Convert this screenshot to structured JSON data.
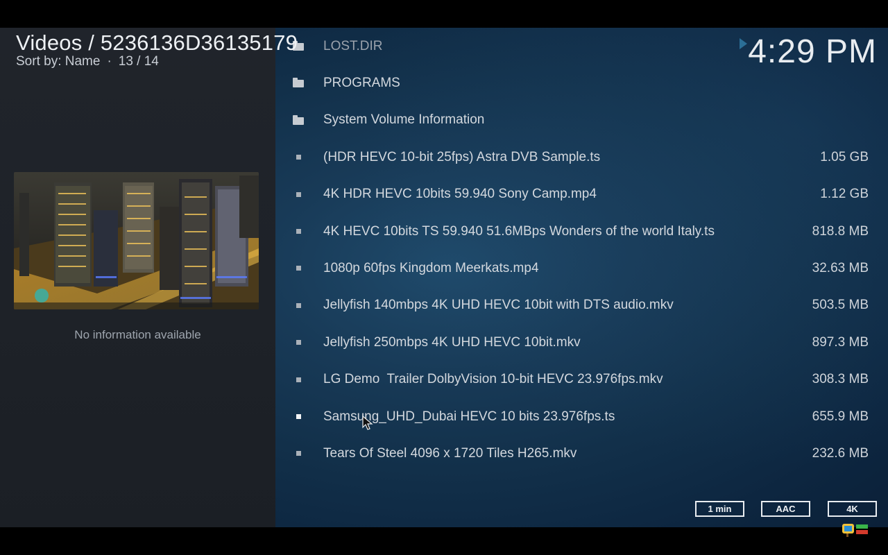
{
  "header": {
    "title": "Videos / 5236136D36135179",
    "sort_label": "Sort by: Name",
    "separator": "·",
    "position": "13 / 14"
  },
  "clock": "4:29 PM",
  "info_panel": {
    "no_info_text": "No information available"
  },
  "files": [
    {
      "type": "folder",
      "name": "LOST.DIR",
      "size": ""
    },
    {
      "type": "folder",
      "name": "PROGRAMS",
      "size": ""
    },
    {
      "type": "folder",
      "name": "System Volume Information",
      "size": ""
    },
    {
      "type": "file",
      "name": "(HDR HEVC 10-bit 25fps) Astra DVB Sample.ts",
      "size": "1.05 GB"
    },
    {
      "type": "file",
      "name": "4K HDR HEVC 10bits 59.940 Sony Camp.mp4",
      "size": "1.12 GB"
    },
    {
      "type": "file",
      "name": "4K HEVC 10bits TS 59.940 51.6MBps Wonders of the world Italy.ts",
      "size": "818.8 MB"
    },
    {
      "type": "file",
      "name": "1080p 60fps Kingdom Meerkats.mp4",
      "size": "32.63 MB"
    },
    {
      "type": "file",
      "name": "Jellyfish 140mbps 4K UHD HEVC 10bit with DTS audio.mkv",
      "size": "503.5 MB"
    },
    {
      "type": "file",
      "name": "Jellyfish 250mbps 4K UHD HEVC 10bit.mkv",
      "size": "897.3 MB"
    },
    {
      "type": "file",
      "name": "LG Demo  Trailer DolbyVision 10-bit HEVC 23.976fps.mkv",
      "size": "308.3 MB"
    },
    {
      "type": "file",
      "name": "Samsung_UHD_Dubai HEVC 10 bits 23.976fps.ts",
      "size": "655.9 MB",
      "focused": true
    },
    {
      "type": "file",
      "name": "Tears Of Steel 4096 x 1720 Tiles H265.mkv",
      "size": "232.6 MB"
    }
  ],
  "badges": {
    "duration": "1 min",
    "audio": "AAC",
    "resolution": "4K"
  },
  "colors": {
    "accent": "#2b6f97",
    "panel_bg": "#1e2228",
    "list_bg": "#183a57"
  },
  "icons": {
    "folder": "folder-icon",
    "file": "file-bullet-icon",
    "now_playing": "play-indicator-icon"
  }
}
